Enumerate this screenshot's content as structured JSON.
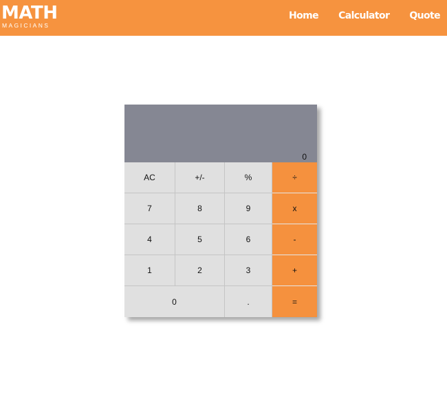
{
  "app": {
    "logo_main": "MATH",
    "logo_sub": "MAGICIANS"
  },
  "nav": {
    "items": [
      {
        "label": "Home"
      },
      {
        "label": "Calculator"
      },
      {
        "label": "Quote"
      }
    ]
  },
  "calculator": {
    "display_value": "0",
    "keys": [
      {
        "label": "AC",
        "type": "function"
      },
      {
        "label": "+/-",
        "type": "function"
      },
      {
        "label": "%",
        "type": "function"
      },
      {
        "label": "÷",
        "type": "operator"
      },
      {
        "label": "7",
        "type": "digit"
      },
      {
        "label": "8",
        "type": "digit"
      },
      {
        "label": "9",
        "type": "digit"
      },
      {
        "label": "x",
        "type": "operator"
      },
      {
        "label": "4",
        "type": "digit"
      },
      {
        "label": "5",
        "type": "digit"
      },
      {
        "label": "6",
        "type": "digit"
      },
      {
        "label": "-",
        "type": "operator"
      },
      {
        "label": "1",
        "type": "digit"
      },
      {
        "label": "2",
        "type": "digit"
      },
      {
        "label": "3",
        "type": "digit"
      },
      {
        "label": "+",
        "type": "operator"
      },
      {
        "label": "0",
        "type": "digit"
      },
      {
        "label": ".",
        "type": "digit"
      },
      {
        "label": "=",
        "type": "operator"
      }
    ]
  },
  "colors": {
    "accent": "#f6933f",
    "display_bg": "#858793",
    "key_bg": "#e0e0e0"
  }
}
